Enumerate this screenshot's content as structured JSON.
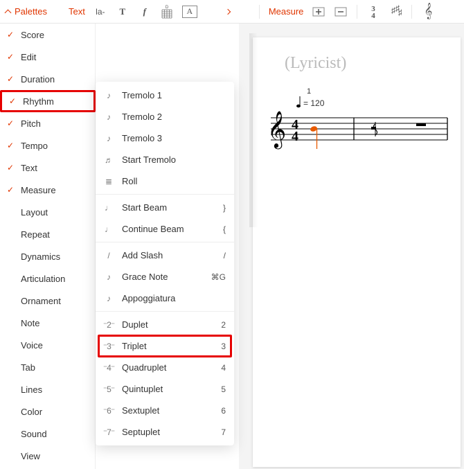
{
  "toolbar": {
    "palettes_label": "Palettes",
    "text_label": "Text",
    "lyrics_icon_text": "la-",
    "bold_text": "T",
    "dynamic_text": "f",
    "textbox_text": "A",
    "measure_label": "Measure",
    "timesig_text": "34"
  },
  "sidebar": {
    "items": [
      {
        "label": "Score",
        "checked": true
      },
      {
        "label": "Edit",
        "checked": true
      },
      {
        "label": "Duration",
        "checked": true
      },
      {
        "label": "Rhythm",
        "checked": true,
        "highlight": true
      },
      {
        "label": "Pitch",
        "checked": true
      },
      {
        "label": "Tempo",
        "checked": true
      },
      {
        "label": "Text",
        "checked": true
      },
      {
        "label": "Measure",
        "checked": true
      },
      {
        "label": "Layout",
        "checked": false
      },
      {
        "label": "Repeat",
        "checked": false
      },
      {
        "label": "Dynamics",
        "checked": false
      },
      {
        "label": "Articulation",
        "checked": false
      },
      {
        "label": "Ornament",
        "checked": false
      },
      {
        "label": "Note",
        "checked": false
      },
      {
        "label": "Voice",
        "checked": false
      },
      {
        "label": "Tab",
        "checked": false
      },
      {
        "label": "Lines",
        "checked": false
      },
      {
        "label": "Color",
        "checked": false
      },
      {
        "label": "Sound",
        "checked": false
      },
      {
        "label": "View",
        "checked": false
      }
    ]
  },
  "submenu": {
    "groups": [
      [
        {
          "label": "Tremolo 1",
          "icon_text": "♪"
        },
        {
          "label": "Tremolo 2",
          "icon_text": "♪"
        },
        {
          "label": "Tremolo 3",
          "icon_text": "♪"
        },
        {
          "label": "Start Tremolo",
          "icon_text": "♬"
        },
        {
          "label": "Roll",
          "icon_text": "≣"
        }
      ],
      [
        {
          "label": "Start Beam",
          "icon_text": "♩",
          "shortcut": "}"
        },
        {
          "label": "Continue Beam",
          "icon_text": "♩",
          "shortcut": "{"
        }
      ],
      [
        {
          "label": "Add Slash",
          "icon_text": "/",
          "shortcut": "/"
        },
        {
          "label": "Grace Note",
          "icon_text": "♪",
          "shortcut": "⌘G"
        },
        {
          "label": "Appoggiatura",
          "icon_text": "♪"
        }
      ],
      [
        {
          "label": "Duplet",
          "icon_text": "⁻2⁻",
          "shortcut": "2"
        },
        {
          "label": "Triplet",
          "icon_text": "⁻3⁻",
          "shortcut": "3",
          "highlight": true
        },
        {
          "label": "Quadruplet",
          "icon_text": "⁻4⁻",
          "shortcut": "4"
        },
        {
          "label": "Quintuplet",
          "icon_text": "⁻5⁻",
          "shortcut": "5"
        },
        {
          "label": "Sextuplet",
          "icon_text": "⁻6⁻",
          "shortcut": "6"
        },
        {
          "label": "Septuplet",
          "icon_text": "⁻7⁻",
          "shortcut": "7"
        }
      ]
    ]
  },
  "score": {
    "lyricist_placeholder": "(Lyricist)",
    "bar_number": "1",
    "tempo_text": "= 120",
    "time_sig_top": "4",
    "time_sig_bottom": "4"
  }
}
